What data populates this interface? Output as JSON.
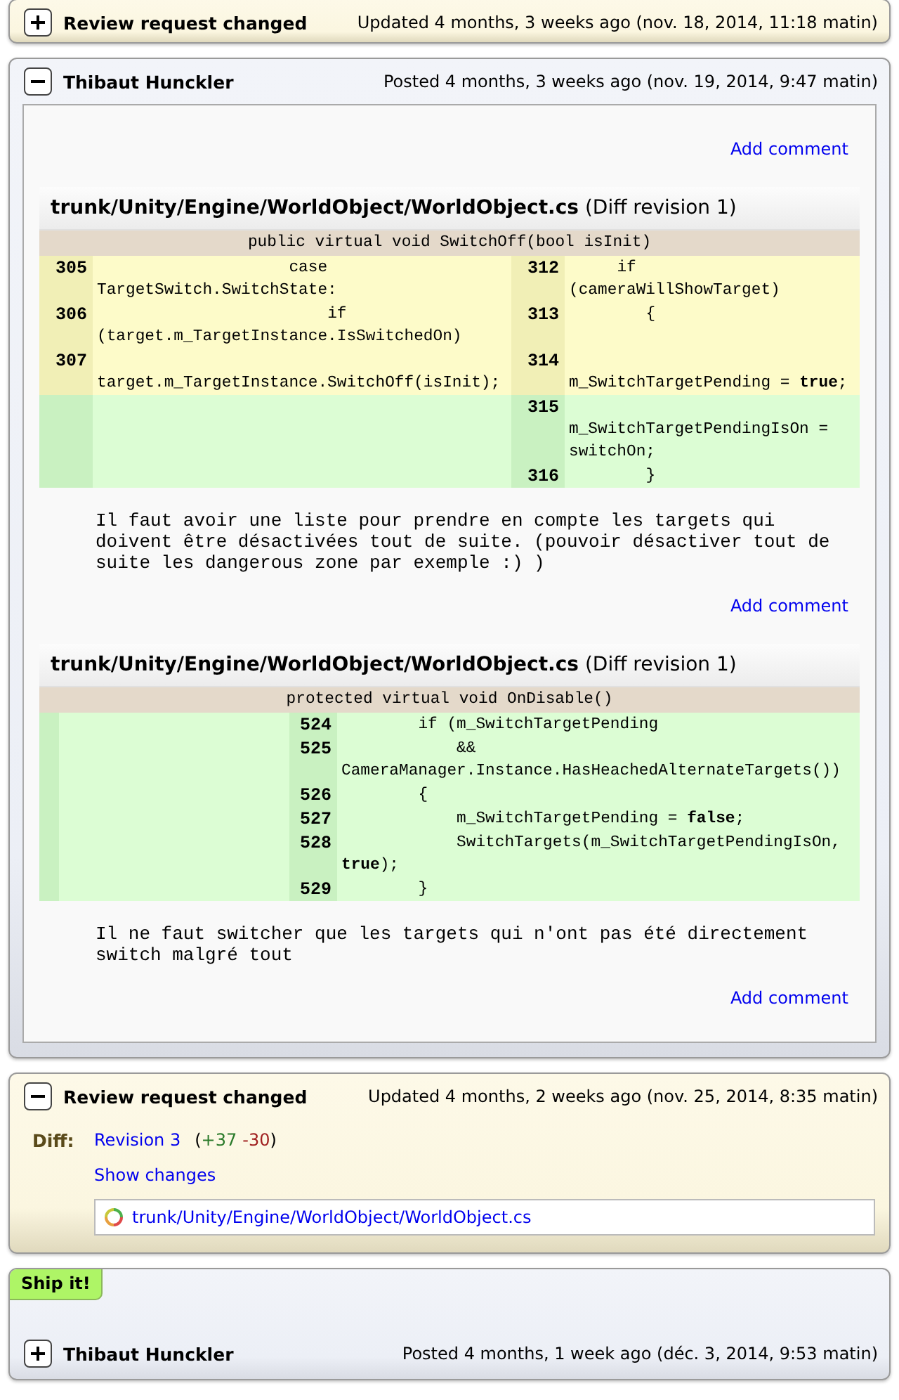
{
  "entries": [
    {
      "kind": "change",
      "expanded": false,
      "title": "Review request changed",
      "timestamp": "Updated 4 months, 3 weeks ago (nov. 18, 2014, 11:18 matin)"
    },
    {
      "kind": "review",
      "expanded": true,
      "author": "Thibaut Hunckler",
      "timestamp": "Posted 4 months, 3 weeks ago (nov. 19, 2014, 9:47 matin)",
      "add_comment": "Add comment",
      "comments": [
        {
          "file": "trunk/Unity/Engine/WorldObject/WorldObject.cs",
          "revision": "(Diff revision 1)",
          "function": "public virtual void SwitchOff(bool isInit)",
          "rows": [
            {
              "kind": "replace",
              "left": {
                "num": "305",
                "code": "                    case TargetSwitch.SwitchState:"
              },
              "right": {
                "num": "312",
                "code": "     if (cameraWillShowTarget)"
              }
            },
            {
              "kind": "replace",
              "left": {
                "num": "306",
                "code": "                        if (target.m_TargetInstance.IsSwitchedOn)"
              },
              "right": {
                "num": "313",
                "code": "        {"
              }
            },
            {
              "kind": "replace",
              "left": {
                "num": "307",
                "code": "                            target.m_TargetInstance.SwitchOff(isInit);"
              },
              "right": {
                "num": "314",
                "code": "            m_SwitchTargetPending = **true**;"
              }
            },
            {
              "kind": "insert",
              "right": {
                "num": "315",
                "code": "            m_SwitchTargetPendingIsOn = switchOn;"
              }
            },
            {
              "kind": "insert",
              "right": {
                "num": "316",
                "code": "        }"
              }
            }
          ],
          "text": "Il faut avoir une liste pour prendre en compte les targets qui doivent être désactivées tout de suite. (pouvoir désactiver tout de suite les dangerous zone par exemple :) )",
          "add_comment": "Add comment"
        },
        {
          "file": "trunk/Unity/Engine/WorldObject/WorldObject.cs",
          "revision": "(Diff revision 1)",
          "function": "protected virtual void OnDisable()",
          "rows": [
            {
              "kind": "insert",
              "right": {
                "num": "524",
                "code": "        if (m_SwitchTargetPending"
              }
            },
            {
              "kind": "insert",
              "right": {
                "num": "525",
                "code": "            && CameraManager.Instance.HasHeachedAlternateTargets())"
              }
            },
            {
              "kind": "insert",
              "right": {
                "num": "526",
                "code": "        {"
              }
            },
            {
              "kind": "insert",
              "right": {
                "num": "527",
                "code": "            m_SwitchTargetPending = **false**;"
              }
            },
            {
              "kind": "insert",
              "right": {
                "num": "528",
                "code": "            SwitchTargets(m_SwitchTargetPendingIsOn, **true**);"
              }
            },
            {
              "kind": "insert",
              "right": {
                "num": "529",
                "code": "        }"
              }
            }
          ],
          "text": "Il ne faut switcher que les targets qui n'ont pas été directement switch malgré tout",
          "add_comment": "Add comment"
        }
      ]
    },
    {
      "kind": "change",
      "expanded": true,
      "title": "Review request changed",
      "timestamp": "Updated 4 months, 2 weeks ago (nov. 25, 2014, 8:35 matin)",
      "diff": {
        "label": "Diff:",
        "revision": "Revision 3",
        "open": "(",
        "added": "+37",
        "removed": "-30",
        "close": ")",
        "show_changes": "Show changes",
        "files": [
          "trunk/Unity/Engine/WorldObject/WorldObject.cs"
        ]
      }
    },
    {
      "kind": "review",
      "expanded": false,
      "ship_it": "Ship it!",
      "author": "Thibaut Hunckler",
      "timestamp": "Posted 4 months, 1 week ago (déc. 3, 2014, 9:53 matin)"
    }
  ]
}
